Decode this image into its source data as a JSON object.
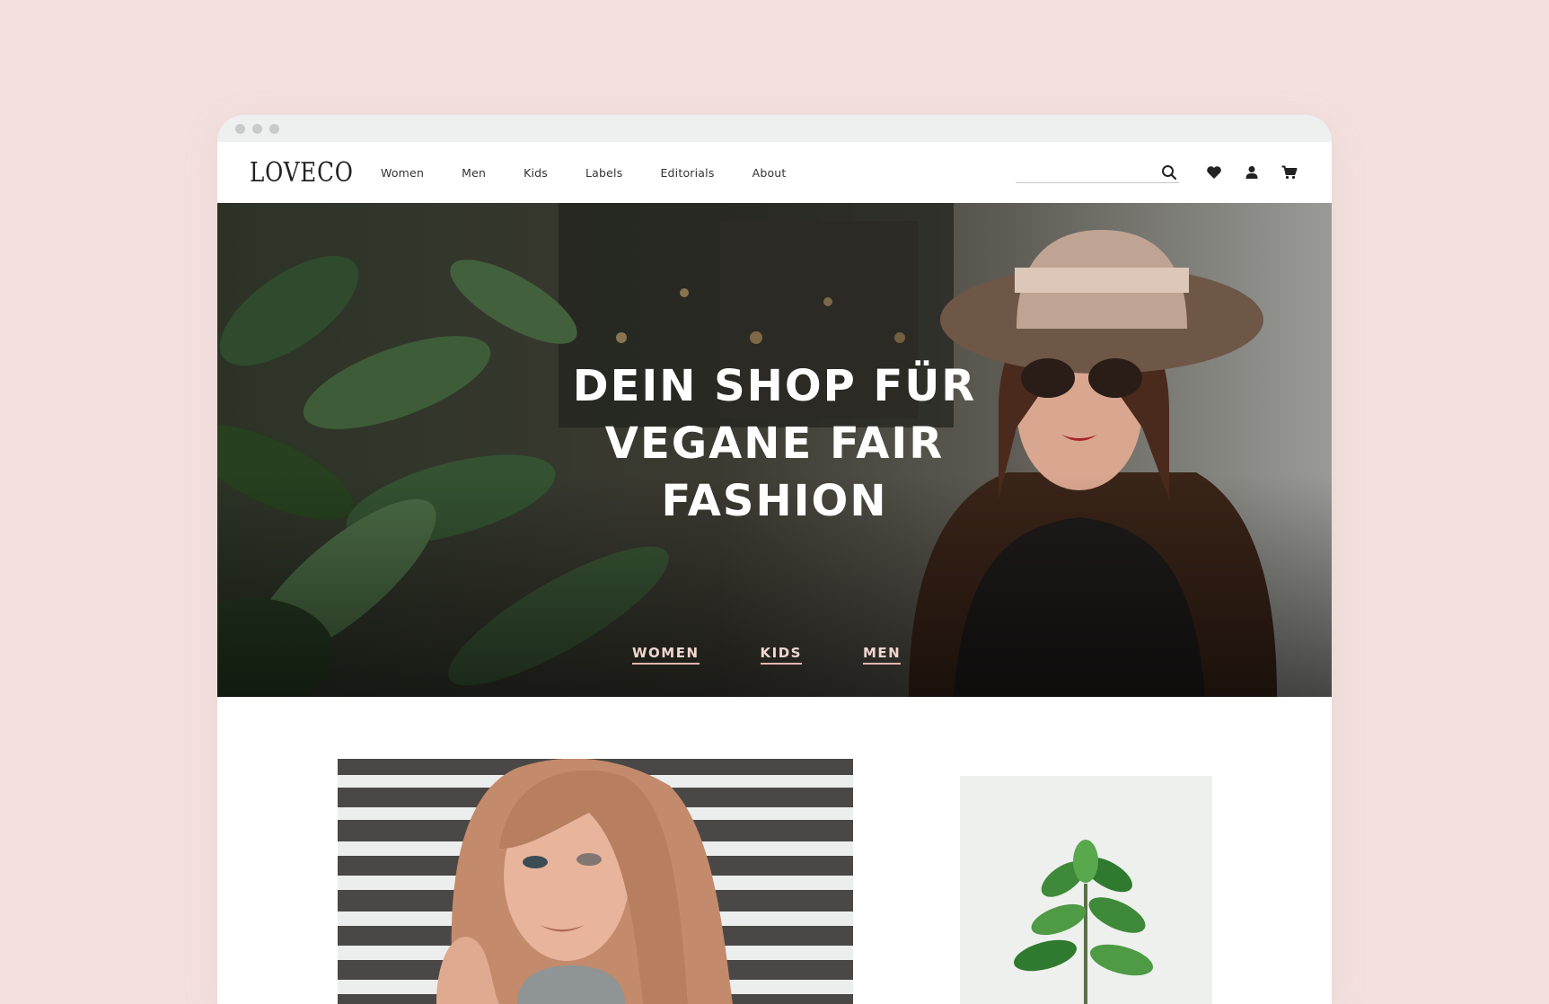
{
  "brand": {
    "logo": "LOVECO"
  },
  "nav": {
    "items": [
      {
        "label": "Women"
      },
      {
        "label": "Men"
      },
      {
        "label": "Kids"
      },
      {
        "label": "Labels"
      },
      {
        "label": "Editorials"
      },
      {
        "label": "About"
      }
    ]
  },
  "search": {
    "placeholder": "",
    "value": ""
  },
  "icons": [
    "search-icon",
    "heart-icon",
    "user-icon",
    "cart-icon"
  ],
  "hero": {
    "title": "DEIN SHOP FÜR\nVEGANE FAIR\nFASHION",
    "links": [
      {
        "label": "WOMEN"
      },
      {
        "label": "KIDS"
      },
      {
        "label": "MEN"
      }
    ]
  },
  "colors": {
    "background": "#f4e1df",
    "accent": "#e2b7ad",
    "text": "#222222"
  }
}
